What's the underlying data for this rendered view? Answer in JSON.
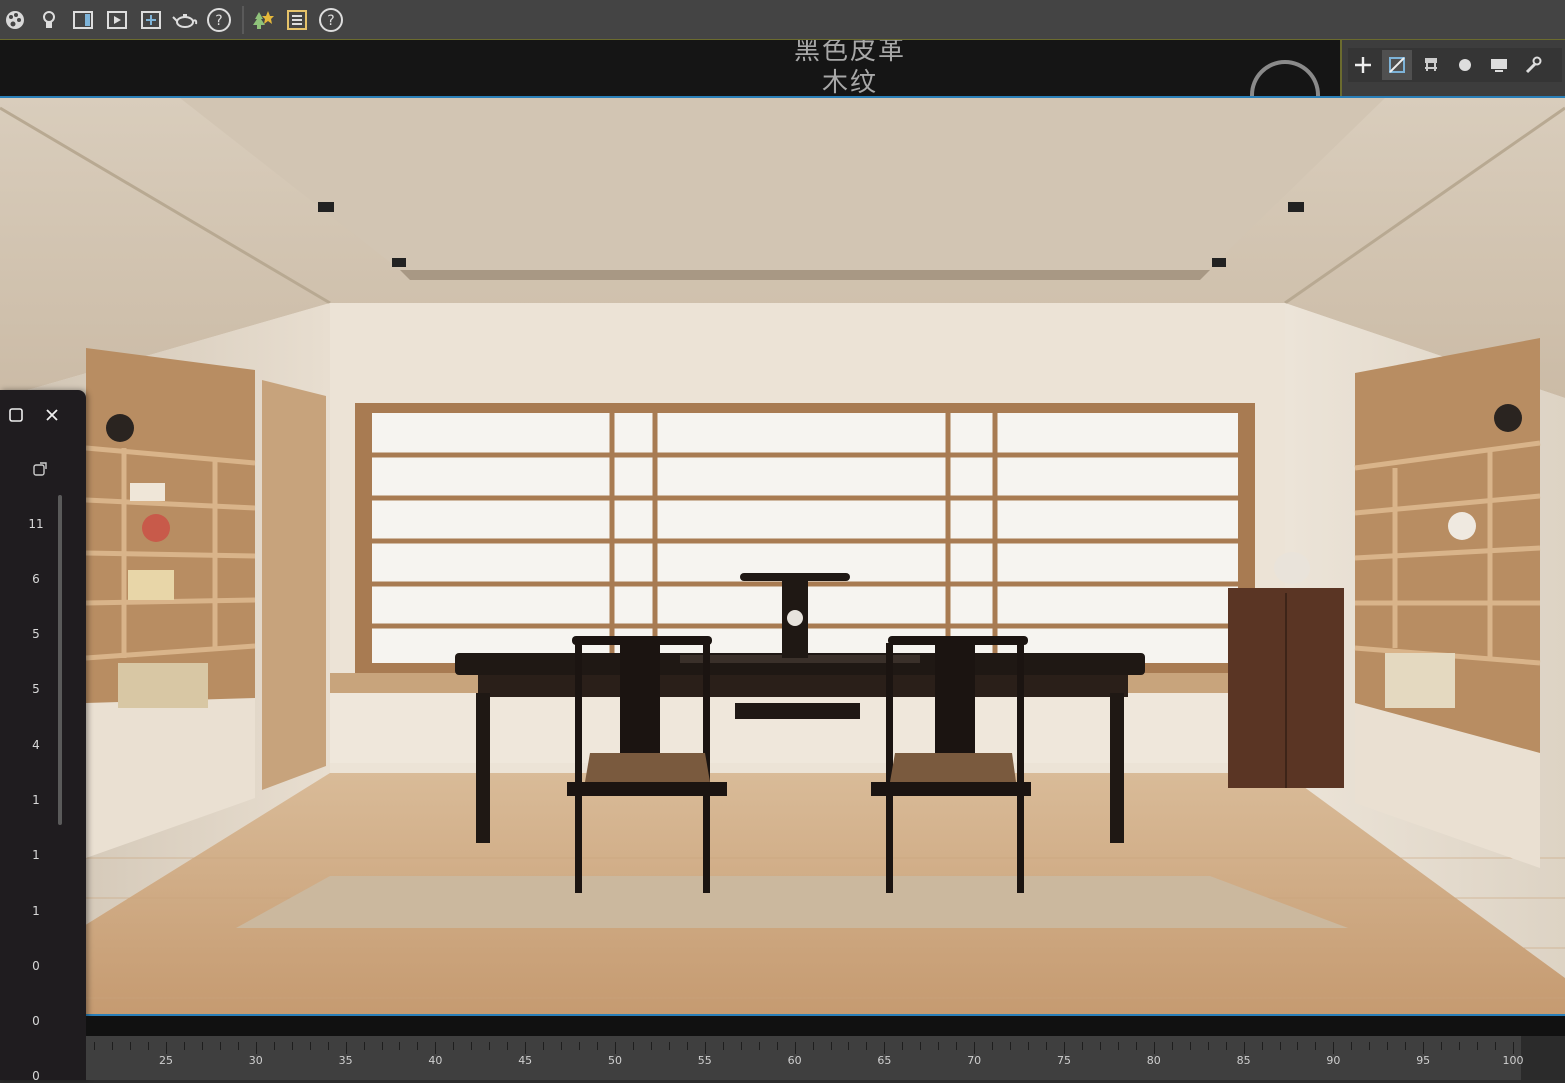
{
  "toolbar": {
    "icons": [
      "palette-icon",
      "light-bulb-icon",
      "render-frame-icon",
      "render-production-icon",
      "render-setup-icon",
      "teapot-icon",
      "help-icon",
      "scatter-trees-icon",
      "scene-list-icon",
      "help-icon"
    ]
  },
  "header": {
    "text_line1": "黑色皮革",
    "text_line2": "木纹"
  },
  "command_panel": {
    "tabs": [
      "create-tab",
      "modify-tab",
      "hierarchy-tab",
      "motion-tab",
      "display-tab",
      "utilities-tab"
    ]
  },
  "side_panel": {
    "numbers": [
      "11",
      "6",
      "5",
      "5",
      "4",
      "1",
      "1",
      "1",
      "0",
      "0",
      "0"
    ]
  },
  "timeline": {
    "labels": [
      "25",
      "30",
      "35",
      "40",
      "45",
      "50",
      "55",
      "60",
      "65",
      "70",
      "75",
      "80",
      "85",
      "90",
      "95",
      "100"
    ]
  },
  "colors": {
    "toolbar_bg": "#444444",
    "viewport_border": "#2a7fb8",
    "accent": "#6b6b2e"
  }
}
